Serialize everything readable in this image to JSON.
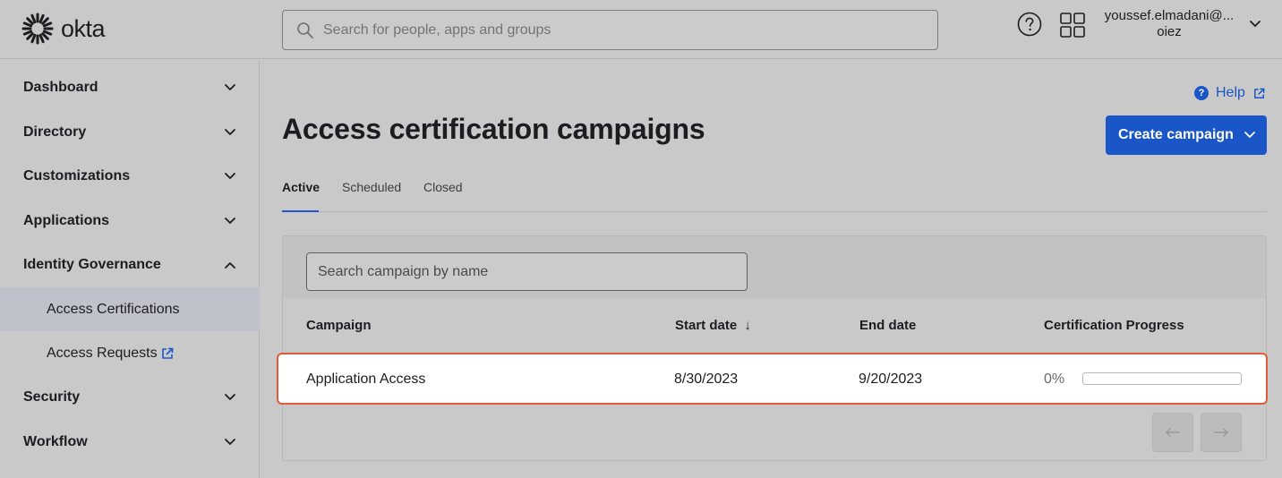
{
  "header": {
    "logo_text": "okta",
    "search_placeholder": "Search for people, apps and groups",
    "user_email": "youssef.elmadani@...",
    "user_org": "oiez"
  },
  "sidebar": {
    "items": [
      {
        "label": "Dashboard",
        "expanded": false
      },
      {
        "label": "Directory",
        "expanded": false
      },
      {
        "label": "Customizations",
        "expanded": false
      },
      {
        "label": "Applications",
        "expanded": false
      },
      {
        "label": "Identity Governance",
        "expanded": true
      },
      {
        "label": "Security",
        "expanded": false
      },
      {
        "label": "Workflow",
        "expanded": false
      }
    ],
    "sub_items": [
      {
        "label": "Access Certifications",
        "selected": true
      },
      {
        "label": "Access Requests",
        "external": true
      }
    ]
  },
  "main": {
    "help_label": "Help",
    "title": "Access certification campaigns",
    "create_button": "Create campaign",
    "tabs": [
      {
        "label": "Active",
        "active": true
      },
      {
        "label": "Scheduled",
        "active": false
      },
      {
        "label": "Closed",
        "active": false
      }
    ],
    "campaign_search_placeholder": "Search campaign by name",
    "table": {
      "columns": [
        "Campaign",
        "Start date",
        "End date",
        "Certification Progress"
      ],
      "sort_indicator": "↓",
      "rows": [
        {
          "campaign": "Application Access",
          "start": "8/30/2023",
          "end": "9/20/2023",
          "progress_label": "0%",
          "progress": 0
        }
      ]
    }
  },
  "colors": {
    "accent": "#1a56c7",
    "highlight_border": "#e05a3c"
  },
  "icons": [
    "okta-logo-icon",
    "search-icon",
    "help-icon",
    "apps-grid-icon",
    "chevron-down-icon",
    "chevron-up-icon",
    "external-link-icon",
    "arrow-left-icon",
    "arrow-right-icon",
    "sort-arrow-icon"
  ]
}
